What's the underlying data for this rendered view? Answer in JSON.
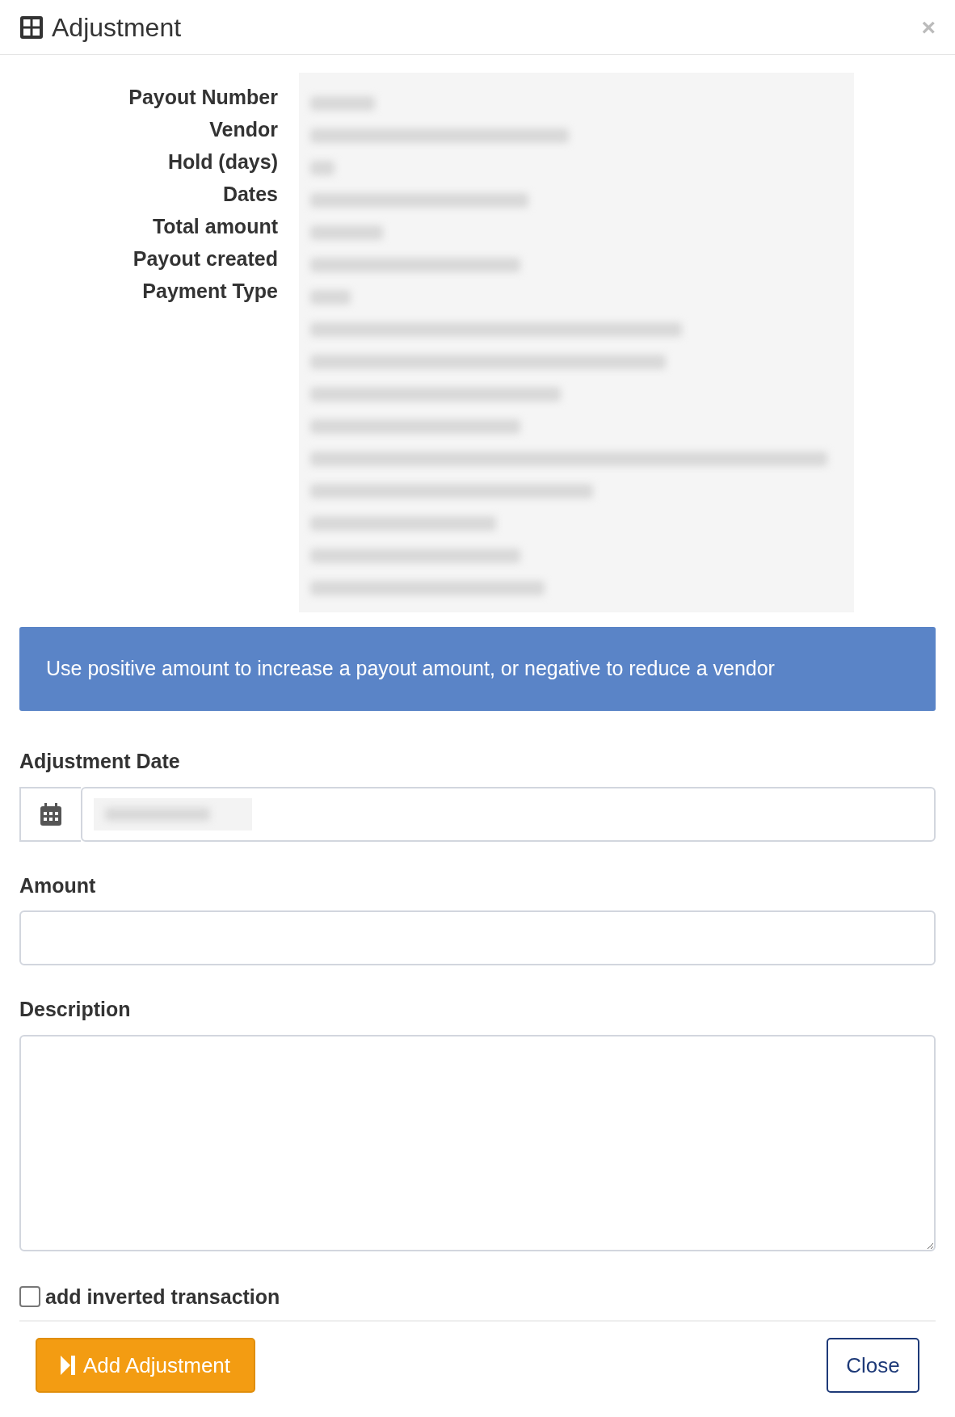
{
  "dialog": {
    "title": "Adjustment",
    "close": "×"
  },
  "details": [
    "Payout Number",
    "Vendor",
    "Hold (days)",
    "Dates",
    "Total amount",
    "Payout created",
    "Payment Type"
  ],
  "info": "Use positive amount to increase a payout amount, or negative to reduce a vendor",
  "form": {
    "date_label": "Adjustment Date",
    "amount_label": "Amount",
    "description_label": "Description"
  },
  "inverted": {
    "label": "add inverted transaction",
    "checked": false
  },
  "buttons": {
    "add": "Add Adjustment",
    "close": "Close"
  }
}
